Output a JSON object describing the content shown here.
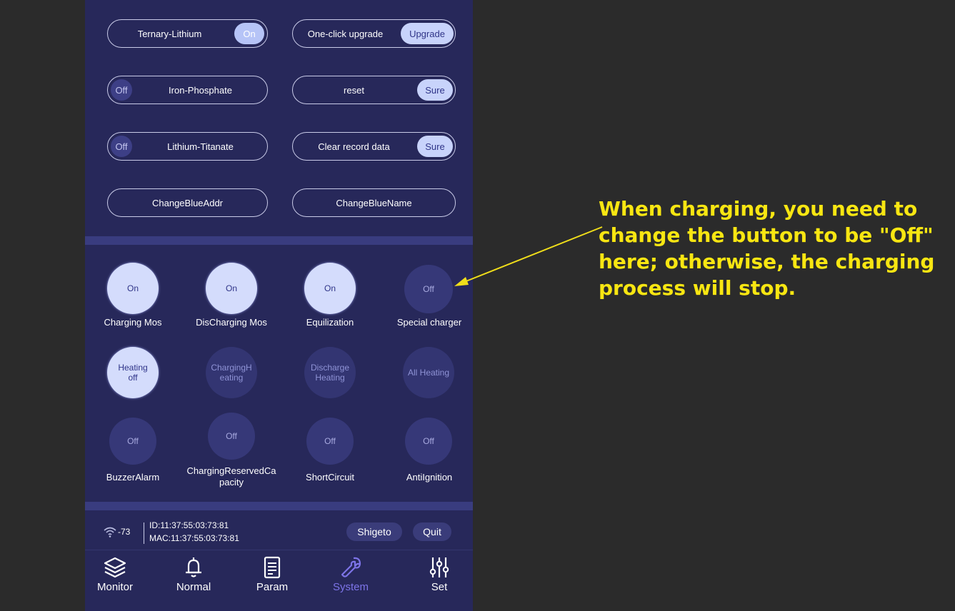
{
  "battery_types": [
    {
      "label": "Ternary-Lithium",
      "toggle": "On",
      "state": "on"
    },
    {
      "label": "Iron-Phosphate",
      "toggle": "Off",
      "state": "off"
    },
    {
      "label": "Lithium-Titanate",
      "toggle": "Off",
      "state": "off"
    }
  ],
  "actions": [
    {
      "label": "One-click upgrade",
      "button": "Upgrade"
    },
    {
      "label": "reset",
      "button": "Sure"
    },
    {
      "label": "Clear record data",
      "button": "Sure"
    }
  ],
  "bluetooth": {
    "addr_button": "ChangeBlueAddr",
    "name_button": "ChangeBlueName"
  },
  "switches": [
    {
      "value": "On",
      "label": "Charging Mos",
      "state": "on"
    },
    {
      "value": "On",
      "label": "DisCharging Mos",
      "state": "on"
    },
    {
      "value": "On",
      "label": "Equilization",
      "state": "on"
    },
    {
      "value": "Off",
      "label": "Special charger",
      "state": "off"
    },
    {
      "value": "Heating off",
      "label": "",
      "state": "on"
    },
    {
      "value": "ChargingHeating",
      "label": "",
      "state": "off"
    },
    {
      "value": "Discharge Heating",
      "label": "",
      "state": "off"
    },
    {
      "value": "All Heating",
      "label": "",
      "state": "off"
    },
    {
      "value": "Off",
      "label": "BuzzerAlarm",
      "state": "off"
    },
    {
      "value": "Off",
      "label": "ChargingReservedCapacity",
      "state": "off"
    },
    {
      "value": "Off",
      "label": "ShortCircuit",
      "state": "off"
    },
    {
      "value": "Off",
      "label": "AntiIgnition",
      "state": "off"
    }
  ],
  "status": {
    "signal": "-73",
    "id": "ID:11:37:55:03:73:81",
    "mac": "MAC:11:37:55:03:73:81",
    "user_button": "Shigeto",
    "quit_button": "Quit"
  },
  "nav": [
    {
      "label": "Monitor",
      "icon": "layers-icon"
    },
    {
      "label": "Normal",
      "icon": "bell-icon"
    },
    {
      "label": "Param",
      "icon": "document-icon"
    },
    {
      "label": "System",
      "icon": "wrench-icon",
      "active": true
    },
    {
      "label": "Set",
      "icon": "sliders-icon"
    }
  ],
  "annotation": "When charging, you need to change the button to be \"Off\" here; otherwise, the charging process will stop.",
  "colors": {
    "background": "#2b2b2b",
    "panel": "#27285a",
    "annotation": "#f8e612",
    "active_nav": "#7d74e8"
  }
}
